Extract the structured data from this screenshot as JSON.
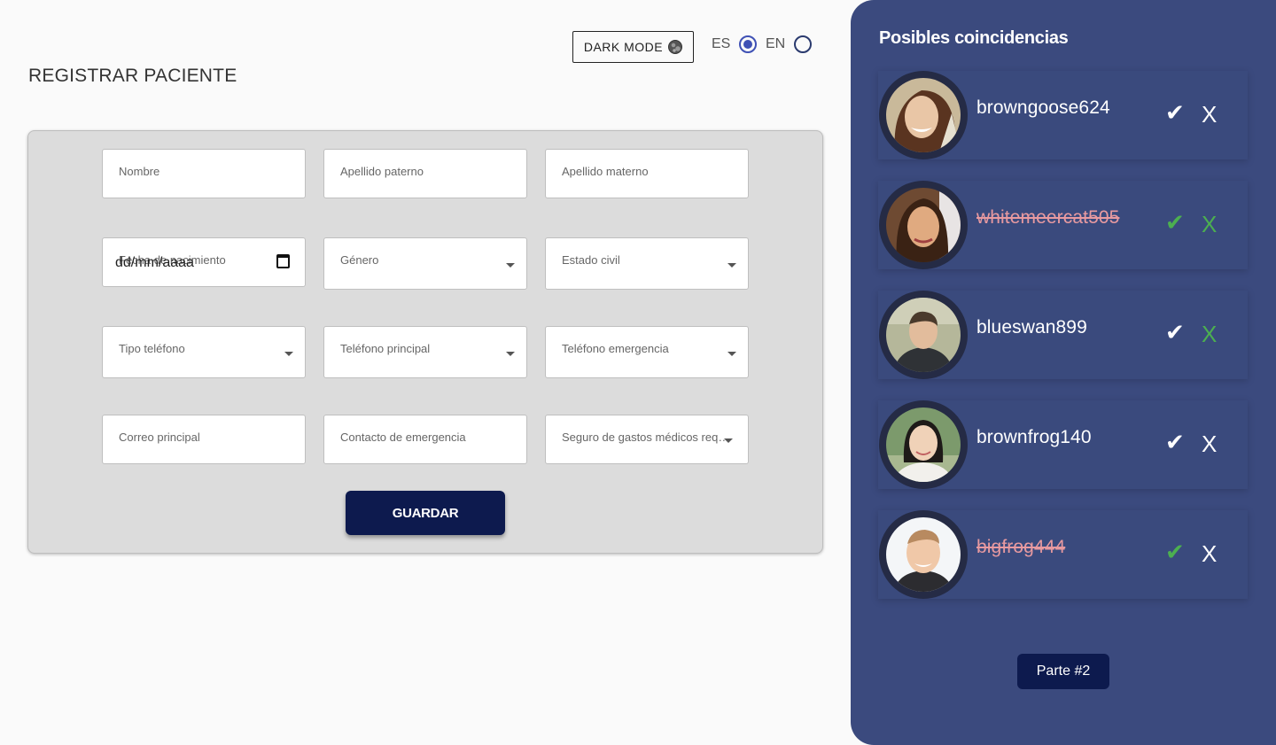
{
  "header": {
    "dark_mode_label": "DARK MODE",
    "lang_es": "ES",
    "lang_en": "EN",
    "selected_lang": "ES"
  },
  "form": {
    "title": "REGISTRAR PACIENTE",
    "fields": {
      "nombre": "Nombre",
      "apellido_paterno": "Apellido paterno",
      "apellido_materno": "Apellido materno",
      "fecha_nacimiento": "Fecha de nacimiento",
      "fecha_value": "dd/mm/aaaa",
      "genero": "Género",
      "estado_civil": "Estado civil",
      "tipo_telefono": "Tipo teléfono",
      "telefono_principal": "Teléfono principal",
      "telefono_emergencia": "Teléfono emergencia",
      "correo_principal": "Correo principal",
      "contacto_emergencia": "Contacto de emergencia",
      "seguro": "Seguro de gastos médicos requerido"
    },
    "save_label": "GUARDAR"
  },
  "panel": {
    "title": "Posibles coincidencias",
    "matches": [
      {
        "username": "browngoose624",
        "struck": false,
        "check_color": "white",
        "x_color": "white"
      },
      {
        "username": "whitemeercat505",
        "struck": true,
        "check_color": "green",
        "x_color": "green"
      },
      {
        "username": "blueswan899",
        "struck": false,
        "check_color": "white",
        "x_color": "green"
      },
      {
        "username": "brownfrog140",
        "struck": false,
        "check_color": "white",
        "x_color": "white"
      },
      {
        "username": "bigfrog444",
        "struck": true,
        "check_color": "green",
        "x_color": "white"
      }
    ],
    "check_glyph": "✔",
    "x_glyph": "X",
    "part_label": "Parte #2"
  },
  "colors": {
    "panel_bg": "#3b4a7e",
    "button_bg": "#0d1a4e",
    "accent_green": "#4caf50",
    "struck_text": "#e89aa0",
    "radio_accent": "#3f51b5"
  }
}
